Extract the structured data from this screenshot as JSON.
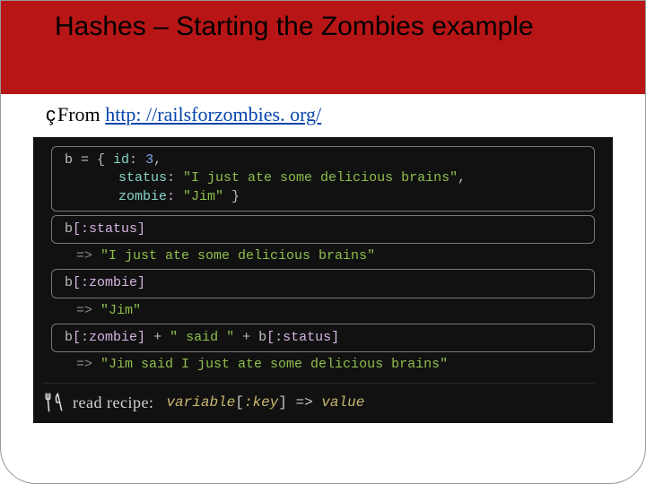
{
  "title": "Hashes – Starting the Zombies example",
  "from_prefix": "From ",
  "from_url": "http: //railsforzombies. org/",
  "code": {
    "block1_l1_a": "b ",
    "block1_l1_b": "= { ",
    "block1_l1_c": "id",
    "block1_l1_d": ": ",
    "block1_l1_e": "3",
    "block1_l1_f": ",",
    "block1_l2_a": "status",
    "block1_l2_b": ": ",
    "block1_l2_c": "\"I just ate some delicious brains\"",
    "block1_l2_d": ",",
    "block1_l3_a": "zombie",
    "block1_l3_b": ": ",
    "block1_l3_c": "\"Jim\"",
    "block1_l3_d": " }",
    "block2_a": "b",
    "block2_b": "[",
    "block2_c": ":status",
    "block2_d": "]",
    "out2_arrow": "=> ",
    "out2_val": "\"I just ate some delicious brains\"",
    "block3_a": "b",
    "block3_b": "[",
    "block3_c": ":zombie",
    "block3_d": "]",
    "out3_arrow": "=> ",
    "out3_val": "\"Jim\"",
    "block4_a": "b",
    "block4_b": "[",
    "block4_c": ":zombie",
    "block4_d": "]",
    "block4_e": " + ",
    "block4_f": "\" said \"",
    "block4_g": " + ",
    "block4_h": "b",
    "block4_i": "[",
    "block4_j": ":status",
    "block4_k": "]",
    "out4_arrow": "=> ",
    "out4_val": "\"Jim said I just ate some delicious brains\""
  },
  "recipe_label": "read recipe:",
  "recipe_code_a": "variable",
  "recipe_code_b": "[",
  "recipe_code_c": ":key",
  "recipe_code_d": "]",
  "recipe_code_e": " => ",
  "recipe_code_f": "value"
}
